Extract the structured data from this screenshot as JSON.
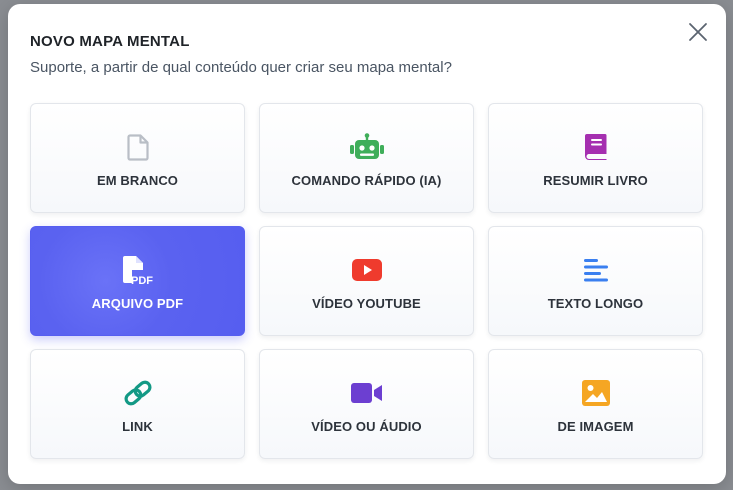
{
  "dialog": {
    "title": "NOVO MAPA MENTAL",
    "subtitle": "Suporte, a partir de qual conteúdo quer criar seu mapa mental?"
  },
  "options": [
    {
      "label": "EM BRANCO",
      "icon": "blank-file-icon",
      "color": "#b9bec6"
    },
    {
      "label": "COMANDO RÁPIDO (IA)",
      "icon": "robot-icon",
      "color": "#3fae5a"
    },
    {
      "label": "RESUMIR LIVRO",
      "icon": "book-icon",
      "color": "#a52fb0"
    },
    {
      "label": "ARQUIVO PDF",
      "icon": "pdf-file-icon",
      "color": "#ffffff",
      "selected": true
    },
    {
      "label": "VÍDEO YOUTUBE",
      "icon": "youtube-icon",
      "color": "#ef3b2d"
    },
    {
      "label": "TEXTO LONGO",
      "icon": "text-lines-icon",
      "color": "#3a7ff0"
    },
    {
      "label": "LINK",
      "icon": "link-icon",
      "color": "#139985"
    },
    {
      "label": "VÍDEO OU ÁUDIO",
      "icon": "video-camera-icon",
      "color": "#6c3fd1"
    },
    {
      "label": "DE IMAGEM",
      "icon": "image-icon",
      "color": "#f5a623"
    }
  ],
  "colors": {
    "selected_card": "#565ef0",
    "overlay": "#8a8d92"
  }
}
